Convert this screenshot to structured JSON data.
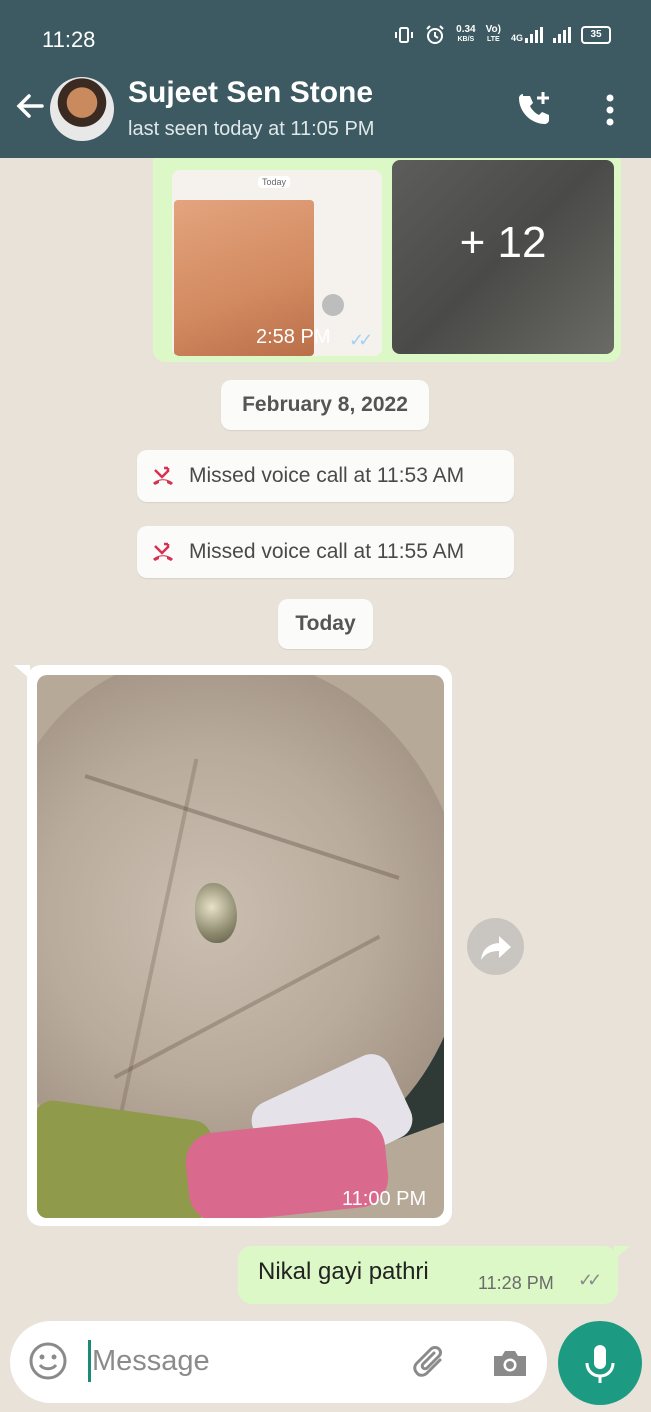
{
  "status_bar": {
    "time": "11:28",
    "net_speed_value": "0.34",
    "net_speed_unit": "KB/S",
    "volte_label_top": "Vo)",
    "volte_label_bottom": "LTE",
    "network_type": "4G",
    "battery": "35"
  },
  "header": {
    "contact_name": "Sujeet Sen Stone",
    "last_seen": "last seen today at 11:05 PM"
  },
  "earlier_media": {
    "thumb_tag": "Today",
    "extra_count": "+ 12",
    "time": "2:58 PM"
  },
  "date_divider": "February 8, 2022",
  "missed_calls": [
    "Missed voice call at 11:53 AM",
    "Missed voice call at 11:55 AM"
  ],
  "today_divider": "Today",
  "incoming_photo": {
    "time": "11:00 PM"
  },
  "outgoing_message": {
    "text": "Nikal gayi pathri",
    "time": "11:28 PM"
  },
  "composer": {
    "placeholder": "Message"
  },
  "colors": {
    "header_bg": "#3d5a62",
    "outgoing_bubble": "#dcf8c6",
    "accent": "#1d9b82",
    "missed_call_red": "#d6314f",
    "read_ticks": "#9fd2f5"
  }
}
